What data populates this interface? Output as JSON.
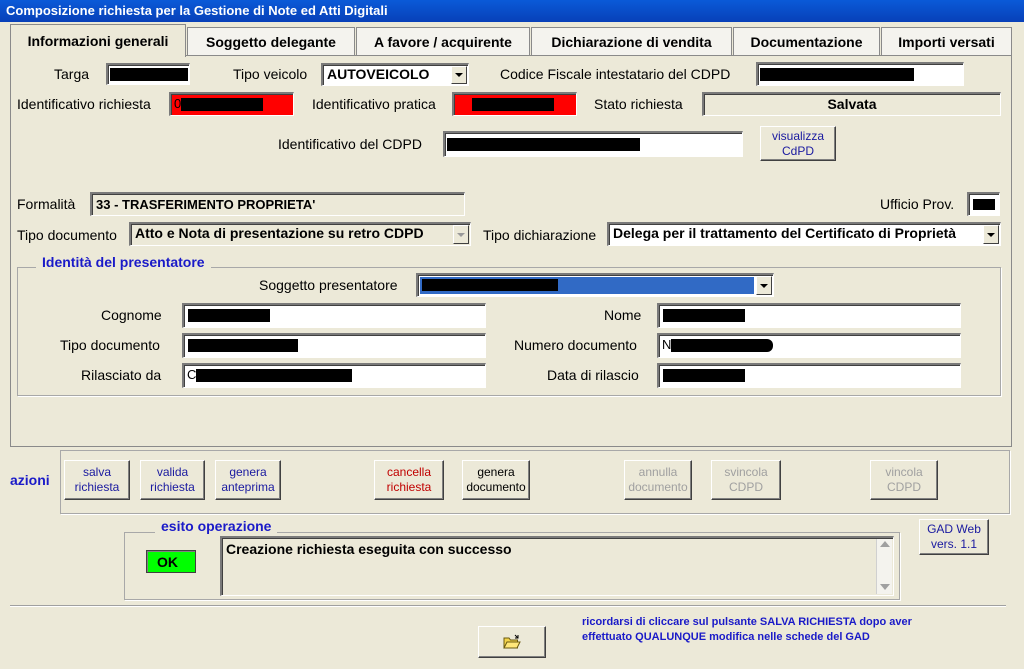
{
  "window": {
    "title": "Composizione richiesta per la Gestione di Note ed Atti Digitali"
  },
  "tabs": [
    {
      "label": "Informazioni generali",
      "active": true
    },
    {
      "label": "Soggetto delegante"
    },
    {
      "label": "A favore / acquirente"
    },
    {
      "label": "Dichiarazione di vendita"
    },
    {
      "label": "Documentazione"
    },
    {
      "label": "Importi versati"
    }
  ],
  "general": {
    "targa_label": "Targa",
    "tipo_veicolo_label": "Tipo veicolo",
    "tipo_veicolo_value": "AUTOVEICOLO",
    "codice_fiscale_label": "Codice Fiscale intestatario del CDPD",
    "id_richiesta_label": "Identificativo richiesta",
    "id_richiesta_prefix": "0",
    "id_pratica_label": "Identificativo pratica",
    "stato_label": "Stato richiesta",
    "stato_value": "Salvata",
    "id_cdpd_label": "Identificativo del CDPD",
    "visualizza_button": "visualizza CdPD",
    "formalita_label": "Formalità",
    "formalita_value": "33 - TRASFERIMENTO PROPRIETA'",
    "ufficio_label": "Ufficio Prov.",
    "tipo_documento_label": "Tipo documento",
    "tipo_documento_value": "Atto e Nota di presentazione su retro CDPD",
    "tipo_dichiarazione_label": "Tipo dichiarazione",
    "tipo_dichiarazione_value": "Delega per il trattamento del Certificato di Proprietà"
  },
  "presentatore": {
    "title": "Identità del presentatore",
    "soggetto_label": "Soggetto presentatore",
    "cognome_label": "Cognome",
    "nome_label": "Nome",
    "tipo_documento_label": "Tipo documento",
    "numero_documento_label": "Numero documento",
    "numero_documento_prefix": "N",
    "rilasciato_label": "Rilasciato da",
    "rilasciato_prefix": "C",
    "data_rilascio_label": "Data di rilascio"
  },
  "azioni": {
    "label": "azioni",
    "salva": "salva richiesta",
    "valida": "valida richiesta",
    "anteprima": "genera anteprima",
    "cancella": "cancella richiesta",
    "genera_documento": "genera documento",
    "annulla": "annulla documento",
    "svincola": "svincola CDPD",
    "vincola": "vincola CDPD"
  },
  "esito": {
    "title": "esito operazione",
    "status": "OK",
    "message": "Creazione richiesta eseguita con successo",
    "version_button": "GAD Web vers. 1.1"
  },
  "footer": {
    "reminder": "ricordarsi di cliccare sul pulsante  SALVA RICHIESTA  dopo aver effettuato QUALUNQUE modifica nelle schede del GAD"
  },
  "colors": {
    "titlebar": "#0a5ad8",
    "ok_green": "#00ff00",
    "highlight_red": "#ff0000",
    "selection_blue": "#316ac5"
  }
}
